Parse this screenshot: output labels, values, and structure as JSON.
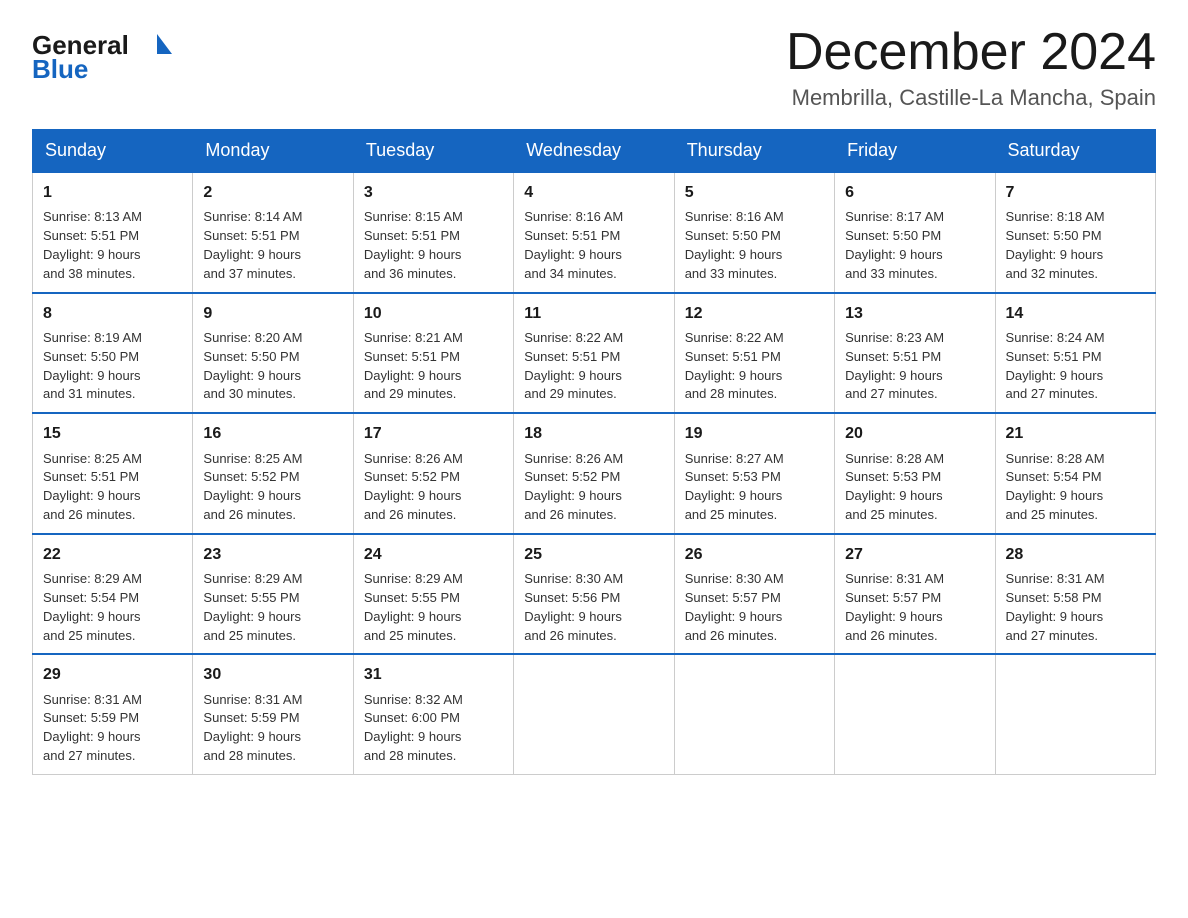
{
  "logo": {
    "general": "General",
    "blue": "Blue"
  },
  "header": {
    "month_title": "December 2024",
    "subtitle": "Membrilla, Castille-La Mancha, Spain"
  },
  "weekdays": [
    "Sunday",
    "Monday",
    "Tuesday",
    "Wednesday",
    "Thursday",
    "Friday",
    "Saturday"
  ],
  "weeks": [
    [
      {
        "day": "1",
        "sunrise": "8:13 AM",
        "sunset": "5:51 PM",
        "daylight": "9 hours and 38 minutes."
      },
      {
        "day": "2",
        "sunrise": "8:14 AM",
        "sunset": "5:51 PM",
        "daylight": "9 hours and 37 minutes."
      },
      {
        "day": "3",
        "sunrise": "8:15 AM",
        "sunset": "5:51 PM",
        "daylight": "9 hours and 36 minutes."
      },
      {
        "day": "4",
        "sunrise": "8:16 AM",
        "sunset": "5:51 PM",
        "daylight": "9 hours and 34 minutes."
      },
      {
        "day": "5",
        "sunrise": "8:16 AM",
        "sunset": "5:50 PM",
        "daylight": "9 hours and 33 minutes."
      },
      {
        "day": "6",
        "sunrise": "8:17 AM",
        "sunset": "5:50 PM",
        "daylight": "9 hours and 33 minutes."
      },
      {
        "day": "7",
        "sunrise": "8:18 AM",
        "sunset": "5:50 PM",
        "daylight": "9 hours and 32 minutes."
      }
    ],
    [
      {
        "day": "8",
        "sunrise": "8:19 AM",
        "sunset": "5:50 PM",
        "daylight": "9 hours and 31 minutes."
      },
      {
        "day": "9",
        "sunrise": "8:20 AM",
        "sunset": "5:50 PM",
        "daylight": "9 hours and 30 minutes."
      },
      {
        "day": "10",
        "sunrise": "8:21 AM",
        "sunset": "5:51 PM",
        "daylight": "9 hours and 29 minutes."
      },
      {
        "day": "11",
        "sunrise": "8:22 AM",
        "sunset": "5:51 PM",
        "daylight": "9 hours and 29 minutes."
      },
      {
        "day": "12",
        "sunrise": "8:22 AM",
        "sunset": "5:51 PM",
        "daylight": "9 hours and 28 minutes."
      },
      {
        "day": "13",
        "sunrise": "8:23 AM",
        "sunset": "5:51 PM",
        "daylight": "9 hours and 27 minutes."
      },
      {
        "day": "14",
        "sunrise": "8:24 AM",
        "sunset": "5:51 PM",
        "daylight": "9 hours and 27 minutes."
      }
    ],
    [
      {
        "day": "15",
        "sunrise": "8:25 AM",
        "sunset": "5:51 PM",
        "daylight": "9 hours and 26 minutes."
      },
      {
        "day": "16",
        "sunrise": "8:25 AM",
        "sunset": "5:52 PM",
        "daylight": "9 hours and 26 minutes."
      },
      {
        "day": "17",
        "sunrise": "8:26 AM",
        "sunset": "5:52 PM",
        "daylight": "9 hours and 26 minutes."
      },
      {
        "day": "18",
        "sunrise": "8:26 AM",
        "sunset": "5:52 PM",
        "daylight": "9 hours and 26 minutes."
      },
      {
        "day": "19",
        "sunrise": "8:27 AM",
        "sunset": "5:53 PM",
        "daylight": "9 hours and 25 minutes."
      },
      {
        "day": "20",
        "sunrise": "8:28 AM",
        "sunset": "5:53 PM",
        "daylight": "9 hours and 25 minutes."
      },
      {
        "day": "21",
        "sunrise": "8:28 AM",
        "sunset": "5:54 PM",
        "daylight": "9 hours and 25 minutes."
      }
    ],
    [
      {
        "day": "22",
        "sunrise": "8:29 AM",
        "sunset": "5:54 PM",
        "daylight": "9 hours and 25 minutes."
      },
      {
        "day": "23",
        "sunrise": "8:29 AM",
        "sunset": "5:55 PM",
        "daylight": "9 hours and 25 minutes."
      },
      {
        "day": "24",
        "sunrise": "8:29 AM",
        "sunset": "5:55 PM",
        "daylight": "9 hours and 25 minutes."
      },
      {
        "day": "25",
        "sunrise": "8:30 AM",
        "sunset": "5:56 PM",
        "daylight": "9 hours and 26 minutes."
      },
      {
        "day": "26",
        "sunrise": "8:30 AM",
        "sunset": "5:57 PM",
        "daylight": "9 hours and 26 minutes."
      },
      {
        "day": "27",
        "sunrise": "8:31 AM",
        "sunset": "5:57 PM",
        "daylight": "9 hours and 26 minutes."
      },
      {
        "day": "28",
        "sunrise": "8:31 AM",
        "sunset": "5:58 PM",
        "daylight": "9 hours and 27 minutes."
      }
    ],
    [
      {
        "day": "29",
        "sunrise": "8:31 AM",
        "sunset": "5:59 PM",
        "daylight": "9 hours and 27 minutes."
      },
      {
        "day": "30",
        "sunrise": "8:31 AM",
        "sunset": "5:59 PM",
        "daylight": "9 hours and 28 minutes."
      },
      {
        "day": "31",
        "sunrise": "8:32 AM",
        "sunset": "6:00 PM",
        "daylight": "9 hours and 28 minutes."
      },
      null,
      null,
      null,
      null
    ]
  ]
}
